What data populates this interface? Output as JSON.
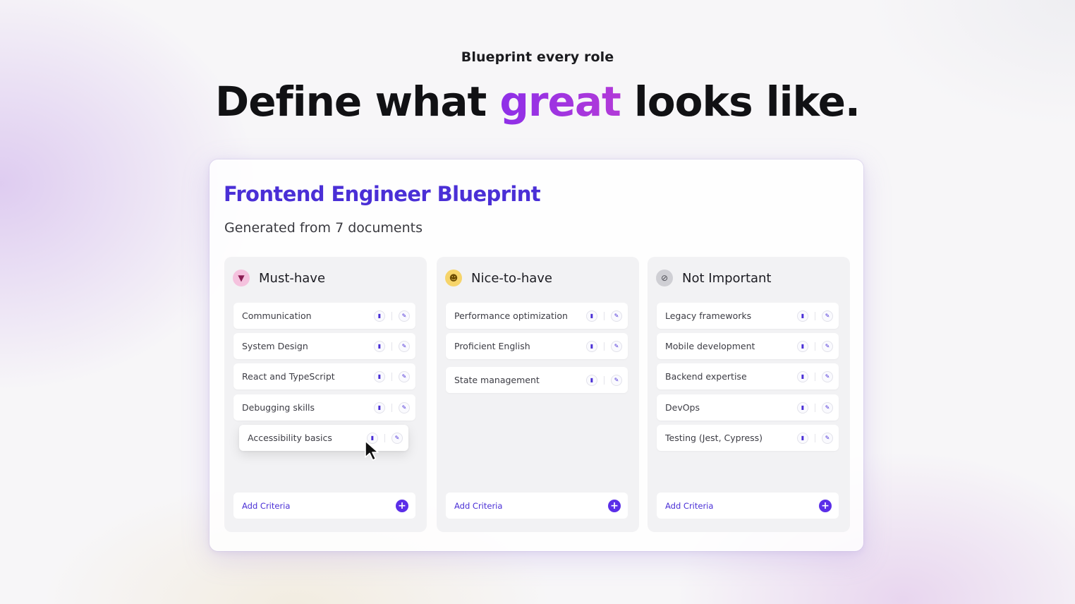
{
  "hero": {
    "eyebrow": "Blueprint every role",
    "headline_before": "Define what ",
    "headline_accent": "great",
    "headline_after": " looks like."
  },
  "blueprint": {
    "title": "Frontend Engineer Blueprint",
    "subtitle": "Generated from 7 documents",
    "columns": [
      {
        "title": "Must-have",
        "icon": "trophy-icon",
        "color": "#f5c2de",
        "items": [
          "Communication",
          "System Design",
          "React and TypeScript",
          "Debugging skills",
          "Accessibility basics"
        ],
        "add_label": "Add Criteria"
      },
      {
        "title": "Nice-to-have",
        "icon": "smile-icon",
        "color": "#f6d46a",
        "items": [
          "Performance optimization",
          "Proficient English",
          "State management"
        ],
        "add_label": "Add Criteria"
      },
      {
        "title": "Not Important",
        "icon": "block-icon",
        "color": "#cfcfd4",
        "items": [
          "Legacy frameworks",
          "Mobile development",
          "Backend expertise",
          "DevOps",
          "Testing (Jest, Cypress)"
        ],
        "add_label": "Add Criteria"
      }
    ]
  },
  "colors": {
    "accent": "#4a2fd6",
    "headline_accent": "#9b30e6",
    "add_button": "#5b2ee8"
  }
}
